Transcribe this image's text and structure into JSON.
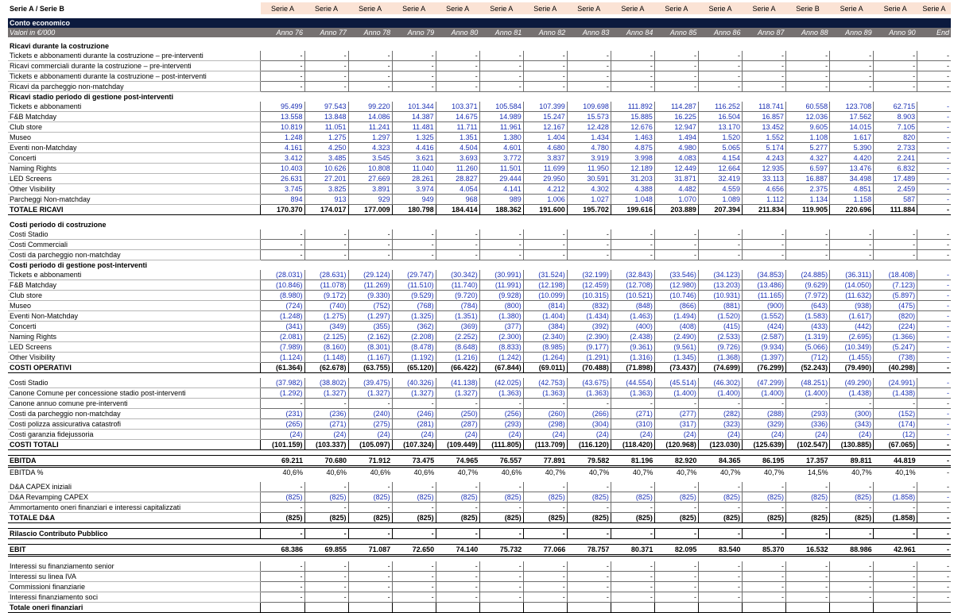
{
  "header": {
    "label": "Serie A / Serie B",
    "series": [
      "Serie A",
      "Serie A",
      "Serie A",
      "Serie A",
      "Serie A",
      "Serie A",
      "Serie A",
      "Serie A",
      "Serie A",
      "Serie A",
      "Serie A",
      "Serie A",
      "Serie B",
      "Serie A",
      "Serie A",
      "Serie A"
    ]
  },
  "band": {
    "title": "Conto economico",
    "subtitle": "Valori in €/000"
  },
  "years": [
    "Anno 76",
    "Anno 77",
    "Anno 78",
    "Anno 79",
    "Anno 80",
    "Anno 81",
    "Anno 82",
    "Anno 83",
    "Anno 84",
    "Anno 85",
    "Anno 86",
    "Anno 87",
    "Anno 88",
    "Anno 89",
    "Anno 90",
    "End"
  ],
  "rows": [
    {
      "type": "gap"
    },
    {
      "type": "sec",
      "label": "Ricavi durante la costruzione"
    },
    {
      "type": "row",
      "label": "Tickets e abbonamenti durante la costruzione – pre-interventi",
      "v": [
        "-",
        "-",
        "-",
        "-",
        "-",
        "-",
        "-",
        "-",
        "-",
        "-",
        "-",
        "-",
        "-",
        "-",
        "-",
        "-"
      ]
    },
    {
      "type": "row",
      "label": "Ricavi commerciali durante la costruzione – pre-interventi",
      "v": [
        "-",
        "-",
        "-",
        "-",
        "-",
        "-",
        "-",
        "-",
        "-",
        "-",
        "-",
        "-",
        "-",
        "-",
        "-",
        "-"
      ]
    },
    {
      "type": "row",
      "label": "Tickets e abbonamenti durante la costruzione – post-interventi",
      "v": [
        "-",
        "-",
        "-",
        "-",
        "-",
        "-",
        "-",
        "-",
        "-",
        "-",
        "-",
        "-",
        "-",
        "-",
        "-",
        "-"
      ]
    },
    {
      "type": "row",
      "label": "Ricavi da parcheggio non-matchday",
      "v": [
        "-",
        "-",
        "-",
        "-",
        "-",
        "-",
        "-",
        "-",
        "-",
        "-",
        "-",
        "-",
        "-",
        "-",
        "-",
        "-"
      ]
    },
    {
      "type": "sec",
      "label": "Ricavi stadio periodo di gestione post-interventi"
    },
    {
      "type": "row",
      "blue": true,
      "label": "Tickets e abbonamenti",
      "v": [
        "95.499",
        "97.543",
        "99.220",
        "101.344",
        "103.371",
        "105.584",
        "107.399",
        "109.698",
        "111.892",
        "114.287",
        "116.252",
        "118.741",
        "60.558",
        "123.708",
        "62.715",
        "-"
      ]
    },
    {
      "type": "row",
      "blue": true,
      "label": "F&B Matchday",
      "v": [
        "13.558",
        "13.848",
        "14.086",
        "14.387",
        "14.675",
        "14.989",
        "15.247",
        "15.573",
        "15.885",
        "16.225",
        "16.504",
        "16.857",
        "12.036",
        "17.562",
        "8.903",
        "-"
      ]
    },
    {
      "type": "row",
      "blue": true,
      "label": "Club store",
      "v": [
        "10.819",
        "11.051",
        "11.241",
        "11.481",
        "11.711",
        "11.961",
        "12.167",
        "12.428",
        "12.676",
        "12.947",
        "13.170",
        "13.452",
        "9.605",
        "14.015",
        "7.105",
        "-"
      ]
    },
    {
      "type": "row",
      "blue": true,
      "label": "Museo",
      "v": [
        "1.248",
        "1.275",
        "1.297",
        "1.325",
        "1.351",
        "1.380",
        "1.404",
        "1.434",
        "1.463",
        "1.494",
        "1.520",
        "1.552",
        "1.108",
        "1.617",
        "820",
        "-"
      ]
    },
    {
      "type": "row",
      "blue": true,
      "label": "Eventi non-Matchday",
      "v": [
        "4.161",
        "4.250",
        "4.323",
        "4.416",
        "4.504",
        "4.601",
        "4.680",
        "4.780",
        "4.875",
        "4.980",
        "5.065",
        "5.174",
        "5.277",
        "5.390",
        "2.733",
        "-"
      ]
    },
    {
      "type": "row",
      "blue": true,
      "label": "Concerti",
      "v": [
        "3.412",
        "3.485",
        "3.545",
        "3.621",
        "3.693",
        "3.772",
        "3.837",
        "3.919",
        "3.998",
        "4.083",
        "4.154",
        "4.243",
        "4.327",
        "4.420",
        "2.241",
        "-"
      ]
    },
    {
      "type": "row",
      "blue": true,
      "label": "Naming Rights",
      "v": [
        "10.403",
        "10.626",
        "10.808",
        "11.040",
        "11.260",
        "11.501",
        "11.699",
        "11.950",
        "12.189",
        "12.449",
        "12.664",
        "12.935",
        "6.597",
        "13.476",
        "6.832",
        "-"
      ]
    },
    {
      "type": "row",
      "blue": true,
      "label": "LED Screens",
      "v": [
        "26.631",
        "27.201",
        "27.669",
        "28.261",
        "28.827",
        "29.444",
        "29.950",
        "30.591",
        "31.203",
        "31.871",
        "32.419",
        "33.113",
        "16.887",
        "34.498",
        "17.489",
        "-"
      ]
    },
    {
      "type": "row",
      "blue": true,
      "label": "Other Visibility",
      "v": [
        "3.745",
        "3.825",
        "3.891",
        "3.974",
        "4.054",
        "4.141",
        "4.212",
        "4.302",
        "4.388",
        "4.482",
        "4.559",
        "4.656",
        "2.375",
        "4.851",
        "2.459",
        "-"
      ]
    },
    {
      "type": "row",
      "blue": true,
      "label": "Parcheggi Non-matchday",
      "v": [
        "894",
        "913",
        "929",
        "949",
        "968",
        "989",
        "1.006",
        "1.027",
        "1.048",
        "1.070",
        "1.089",
        "1.112",
        "1.134",
        "1.158",
        "587",
        "-"
      ]
    },
    {
      "type": "tot",
      "label": "TOTALE RICAVI",
      "v": [
        "170.370",
        "174.017",
        "177.009",
        "180.798",
        "184.414",
        "188.362",
        "191.600",
        "195.702",
        "199.616",
        "203.889",
        "207.394",
        "211.834",
        "119.905",
        "220.696",
        "111.884",
        "-"
      ]
    },
    {
      "type": "sp"
    },
    {
      "type": "sec",
      "label": "Costi periodo di costruzione"
    },
    {
      "type": "row",
      "label": "Costi Stadio",
      "v": [
        "-",
        "-",
        "-",
        "-",
        "-",
        "-",
        "-",
        "-",
        "-",
        "-",
        "-",
        "-",
        "-",
        "-",
        "-",
        "-"
      ]
    },
    {
      "type": "row",
      "label": "Costi Commerciali",
      "v": [
        "-",
        "-",
        "-",
        "-",
        "-",
        "-",
        "-",
        "-",
        "-",
        "-",
        "-",
        "-",
        "-",
        "-",
        "-",
        "-"
      ]
    },
    {
      "type": "row",
      "label": "Costi da parcheggio non-matchday",
      "v": [
        "-",
        "-",
        "-",
        "-",
        "-",
        "-",
        "-",
        "-",
        "-",
        "-",
        "-",
        "-",
        "-",
        "-",
        "-",
        "-"
      ]
    },
    {
      "type": "sec",
      "label": "Costi periodo di gestione post-interventi"
    },
    {
      "type": "row",
      "blue": true,
      "label": "Tickets e abbonamenti",
      "v": [
        "(28.031)",
        "(28.631)",
        "(29.124)",
        "(29.747)",
        "(30.342)",
        "(30.991)",
        "(31.524)",
        "(32.199)",
        "(32.843)",
        "(33.546)",
        "(34.123)",
        "(34.853)",
        "(24.885)",
        "(36.311)",
        "(18.408)",
        "-"
      ]
    },
    {
      "type": "row",
      "blue": true,
      "label": "F&B Matchday",
      "v": [
        "(10.846)",
        "(11.078)",
        "(11.269)",
        "(11.510)",
        "(11.740)",
        "(11.991)",
        "(12.198)",
        "(12.459)",
        "(12.708)",
        "(12.980)",
        "(13.203)",
        "(13.486)",
        "(9.629)",
        "(14.050)",
        "(7.123)",
        "-"
      ]
    },
    {
      "type": "row",
      "blue": true,
      "label": "Club store",
      "v": [
        "(8.980)",
        "(9.172)",
        "(9.330)",
        "(9.529)",
        "(9.720)",
        "(9.928)",
        "(10.099)",
        "(10.315)",
        "(10.521)",
        "(10.746)",
        "(10.931)",
        "(11.165)",
        "(7.972)",
        "(11.632)",
        "(5.897)",
        "-"
      ]
    },
    {
      "type": "row",
      "blue": true,
      "label": "Museo",
      "v": [
        "(724)",
        "(740)",
        "(752)",
        "(768)",
        "(784)",
        "(800)",
        "(814)",
        "(832)",
        "(848)",
        "(866)",
        "(881)",
        "(900)",
        "(643)",
        "(938)",
        "(475)",
        "-"
      ]
    },
    {
      "type": "row",
      "blue": true,
      "label": "Eventi Non-Matchday",
      "v": [
        "(1.248)",
        "(1.275)",
        "(1.297)",
        "(1.325)",
        "(1.351)",
        "(1.380)",
        "(1.404)",
        "(1.434)",
        "(1.463)",
        "(1.494)",
        "(1.520)",
        "(1.552)",
        "(1.583)",
        "(1.617)",
        "(820)",
        "-"
      ]
    },
    {
      "type": "row",
      "blue": true,
      "label": "Concerti",
      "v": [
        "(341)",
        "(349)",
        "(355)",
        "(362)",
        "(369)",
        "(377)",
        "(384)",
        "(392)",
        "(400)",
        "(408)",
        "(415)",
        "(424)",
        "(433)",
        "(442)",
        "(224)",
        "-"
      ]
    },
    {
      "type": "row",
      "blue": true,
      "label": "Naming Rights",
      "v": [
        "(2.081)",
        "(2.125)",
        "(2.162)",
        "(2.208)",
        "(2.252)",
        "(2.300)",
        "(2.340)",
        "(2.390)",
        "(2.438)",
        "(2.490)",
        "(2.533)",
        "(2.587)",
        "(1.319)",
        "(2.695)",
        "(1.366)",
        "-"
      ]
    },
    {
      "type": "row",
      "blue": true,
      "label": "LED Screens",
      "v": [
        "(7.989)",
        "(8.160)",
        "(8.301)",
        "(8.478)",
        "(8.648)",
        "(8.833)",
        "(8.985)",
        "(9.177)",
        "(9.361)",
        "(9.561)",
        "(9.726)",
        "(9.934)",
        "(5.066)",
        "(10.349)",
        "(5.247)",
        "-"
      ]
    },
    {
      "type": "row",
      "blue": true,
      "label": "Other Visibility",
      "v": [
        "(1.124)",
        "(1.148)",
        "(1.167)",
        "(1.192)",
        "(1.216)",
        "(1.242)",
        "(1.264)",
        "(1.291)",
        "(1.316)",
        "(1.345)",
        "(1.368)",
        "(1.397)",
        "(712)",
        "(1.455)",
        "(738)",
        "-"
      ]
    },
    {
      "type": "tot",
      "label": "COSTI OPERATIVI",
      "v": [
        "(61.364)",
        "(62.678)",
        "(63.755)",
        "(65.120)",
        "(66.422)",
        "(67.844)",
        "(69.011)",
        "(70.488)",
        "(71.898)",
        "(73.437)",
        "(74.699)",
        "(76.299)",
        "(52.243)",
        "(79.490)",
        "(40.298)",
        "-"
      ]
    },
    {
      "type": "sp"
    },
    {
      "type": "row",
      "blue": true,
      "label": "Costi Stadio",
      "v": [
        "(37.982)",
        "(38.802)",
        "(39.475)",
        "(40.326)",
        "(41.138)",
        "(42.025)",
        "(42.753)",
        "(43.675)",
        "(44.554)",
        "(45.514)",
        "(46.302)",
        "(47.299)",
        "(48.251)",
        "(49.290)",
        "(24.991)",
        "-"
      ]
    },
    {
      "type": "row",
      "blue": true,
      "label": "Canone Comune per concessione stadio post-interventi",
      "v": [
        "(1.292)",
        "(1.327)",
        "(1.327)",
        "(1.327)",
        "(1.327)",
        "(1.363)",
        "(1.363)",
        "(1.363)",
        "(1.363)",
        "(1.400)",
        "(1.400)",
        "(1.400)",
        "(1.400)",
        "(1.438)",
        "(1.438)",
        "-"
      ]
    },
    {
      "type": "row",
      "label": "Canone annuo comune pre-interventi",
      "v": [
        "-",
        "-",
        "-",
        "-",
        "-",
        "-",
        "-",
        "-",
        "-",
        "-",
        "-",
        "-",
        "-",
        "-",
        "-",
        "-"
      ]
    },
    {
      "type": "row",
      "blue": true,
      "label": "Costi da parcheggio non-matchday",
      "v": [
        "(231)",
        "(236)",
        "(240)",
        "(246)",
        "(250)",
        "(256)",
        "(260)",
        "(266)",
        "(271)",
        "(277)",
        "(282)",
        "(288)",
        "(293)",
        "(300)",
        "(152)",
        "-"
      ]
    },
    {
      "type": "row",
      "blue": true,
      "label": "Costi polizza assicurativa catastrofi",
      "v": [
        "(265)",
        "(271)",
        "(275)",
        "(281)",
        "(287)",
        "(293)",
        "(298)",
        "(304)",
        "(310)",
        "(317)",
        "(323)",
        "(329)",
        "(336)",
        "(343)",
        "(174)",
        "-"
      ]
    },
    {
      "type": "row",
      "blue": true,
      "label": "Costi garanzia fidejussoria",
      "v": [
        "(24)",
        "(24)",
        "(24)",
        "(24)",
        "(24)",
        "(24)",
        "(24)",
        "(24)",
        "(24)",
        "(24)",
        "(24)",
        "(24)",
        "(24)",
        "(24)",
        "(12)",
        "-"
      ]
    },
    {
      "type": "tot",
      "label": "COSTI TOTALI",
      "v": [
        "(101.159)",
        "(103.337)",
        "(105.097)",
        "(107.324)",
        "(109.449)",
        "(111.805)",
        "(113.709)",
        "(116.120)",
        "(118.420)",
        "(120.968)",
        "(123.030)",
        "(125.639)",
        "(102.547)",
        "(130.885)",
        "(67.065)",
        "-"
      ]
    },
    {
      "type": "sp"
    },
    {
      "type": "ebitda",
      "label": "EBITDA",
      "v": [
        "69.211",
        "70.680",
        "71.912",
        "73.475",
        "74.965",
        "76.557",
        "77.891",
        "79.582",
        "81.196",
        "82.920",
        "84.365",
        "86.195",
        "17.357",
        "89.811",
        "44.819",
        "-"
      ]
    },
    {
      "type": "plain",
      "label": "EBITDA %",
      "v": [
        "40,6%",
        "40,6%",
        "40,6%",
        "40,6%",
        "40,7%",
        "40,6%",
        "40,7%",
        "40,7%",
        "40,7%",
        "40,7%",
        "40,7%",
        "40,7%",
        "14,5%",
        "40,7%",
        "40,1%",
        "-"
      ]
    },
    {
      "type": "sp"
    },
    {
      "type": "row",
      "label": "D&A CAPEX iniziali",
      "v": [
        "-",
        "-",
        "-",
        "-",
        "-",
        "-",
        "-",
        "-",
        "-",
        "-",
        "-",
        "-",
        "-",
        "-",
        "-",
        "-"
      ]
    },
    {
      "type": "row",
      "blue": true,
      "label": "D&A Revamping CAPEX",
      "v": [
        "(825)",
        "(825)",
        "(825)",
        "(825)",
        "(825)",
        "(825)",
        "(825)",
        "(825)",
        "(825)",
        "(825)",
        "(825)",
        "(825)",
        "(825)",
        "(825)",
        "(1.858)",
        "-"
      ]
    },
    {
      "type": "row",
      "label": "Ammortamento oneri finanziari e interessi capitalizzati",
      "v": [
        "-",
        "-",
        "-",
        "-",
        "-",
        "-",
        "-",
        "-",
        "-",
        "-",
        "-",
        "-",
        "-",
        "-",
        "-",
        "-"
      ]
    },
    {
      "type": "tot",
      "label": "TOTALE D&A",
      "v": [
        "(825)",
        "(825)",
        "(825)",
        "(825)",
        "(825)",
        "(825)",
        "(825)",
        "(825)",
        "(825)",
        "(825)",
        "(825)",
        "(825)",
        "(825)",
        "(825)",
        "(1.858)",
        "-"
      ]
    },
    {
      "type": "sp"
    },
    {
      "type": "tot",
      "label": "Rilascio Contributo Pubblico",
      "v": [
        "-",
        "-",
        "-",
        "-",
        "-",
        "-",
        "-",
        "-",
        "-",
        "-",
        "-",
        "-",
        "-",
        "-",
        "-",
        "-"
      ]
    },
    {
      "type": "sp"
    },
    {
      "type": "ebit",
      "label": "EBIT",
      "v": [
        "68.386",
        "69.855",
        "71.087",
        "72.650",
        "74.140",
        "75.732",
        "77.066",
        "78.757",
        "80.371",
        "82.095",
        "83.540",
        "85.370",
        "16.532",
        "88.986",
        "42.961",
        "-"
      ]
    },
    {
      "type": "sp"
    },
    {
      "type": "row",
      "label": "Interessi su finanziamento senior",
      "v": [
        "-",
        "-",
        "-",
        "-",
        "-",
        "-",
        "-",
        "-",
        "-",
        "-",
        "-",
        "-",
        "-",
        "-",
        "-",
        "-"
      ]
    },
    {
      "type": "row",
      "label": "Interessi su linea IVA",
      "v": [
        "-",
        "-",
        "-",
        "-",
        "-",
        "-",
        "-",
        "-",
        "-",
        "-",
        "-",
        "-",
        "-",
        "-",
        "-",
        "-"
      ]
    },
    {
      "type": "row",
      "label": "Commissioni finanziarie",
      "v": [
        "-",
        "-",
        "-",
        "-",
        "-",
        "-",
        "-",
        "-",
        "-",
        "-",
        "-",
        "-",
        "-",
        "-",
        "-",
        "-"
      ]
    },
    {
      "type": "row",
      "label": "Interessi finanziamento soci",
      "v": [
        "-",
        "-",
        "-",
        "-",
        "-",
        "-",
        "-",
        "-",
        "-",
        "-",
        "-",
        "-",
        "-",
        "-",
        "-",
        "-"
      ]
    },
    {
      "type": "tot",
      "label": "Totale oneri finanziari",
      "v": [
        "",
        "",
        "",
        "",
        "",
        "",
        "",
        "",
        "",
        "",
        "",
        "",
        "",
        "",
        "",
        ""
      ]
    }
  ]
}
